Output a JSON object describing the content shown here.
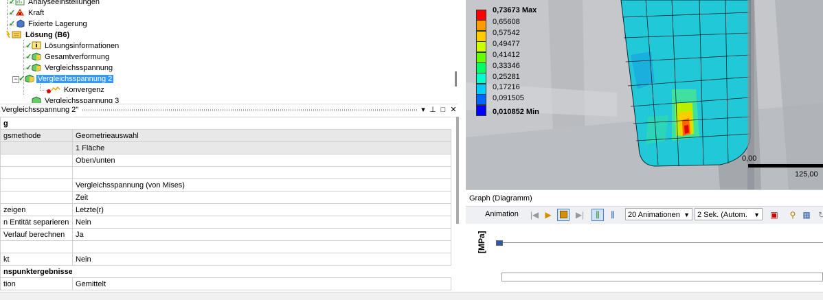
{
  "tree": {
    "items": [
      {
        "label": "Analyseeinstellungen",
        "icon": "analysis-settings-icon"
      },
      {
        "label": "Kraft",
        "icon": "force-icon"
      },
      {
        "label": "Fixierte Lagerung",
        "icon": "fixed-support-icon"
      },
      {
        "label": "Lösung (B6)",
        "icon": "solution-icon"
      },
      {
        "label": "Lösungsinformationen",
        "icon": "solution-info-icon"
      },
      {
        "label": "Gesamtverformung",
        "icon": "result-icon"
      },
      {
        "label": "Vergleichsspannung",
        "icon": "result-icon"
      },
      {
        "label": "Vergleichsspannung 2",
        "icon": "result-icon"
      },
      {
        "label": "Konvergenz",
        "icon": "convergence-icon"
      },
      {
        "label": "Vergleichsspannung 3",
        "icon": "result-icon"
      }
    ]
  },
  "details": {
    "title": "Vergleichsspannung 2\"",
    "rows": [
      {
        "k": "g",
        "v": "",
        "type": "group"
      },
      {
        "k": "gsmethode",
        "v": "Geometrieauswahl",
        "type": "hl"
      },
      {
        "k": "",
        "v": "1 Fläche",
        "type": "hl"
      },
      {
        "k": "",
        "v": "Oben/unten",
        "type": ""
      },
      {
        "k": "",
        "v": "",
        "type": ""
      },
      {
        "k": "",
        "v": "Vergleichsspannung (von Mises)",
        "type": ""
      },
      {
        "k": "",
        "v": "Zeit",
        "type": ""
      },
      {
        "k": "zeigen",
        "v": "Letzte(r)",
        "type": ""
      },
      {
        "k": "n Entität separieren",
        "v": "Nein",
        "type": ""
      },
      {
        "k": "Verlauf berechnen",
        "v": "Ja",
        "type": ""
      },
      {
        "k": "",
        "v": "",
        "type": ""
      },
      {
        "k": "kt",
        "v": "Nein",
        "type": ""
      },
      {
        "k": "nspunktergebnisse",
        "v": "",
        "type": "group"
      },
      {
        "k": "tion",
        "v": "Gemittelt",
        "type": ""
      }
    ]
  },
  "legend": {
    "max_label": "0,73673 Max",
    "values": [
      "0,65608",
      "0,57542",
      "0,49477",
      "0,41412",
      "0,33346",
      "0,25281",
      "0,17216",
      "0,091505"
    ],
    "min_label": "0,010852 Min",
    "colors": [
      "#ff0000",
      "#ff9900",
      "#ffcc00",
      "#ccff00",
      "#66ff00",
      "#00ff66",
      "#00ffcc",
      "#00ccff",
      "#0066ff",
      "#0000ff"
    ]
  },
  "scale": {
    "start": "0,00",
    "end": "125,00"
  },
  "graph": {
    "title": "Graph (Diagramm)",
    "animation_label": "Animation",
    "frames_value": "20 Animationen",
    "duration_value": "2 Sek. (Autom.",
    "y_unit": "[MPa]"
  }
}
